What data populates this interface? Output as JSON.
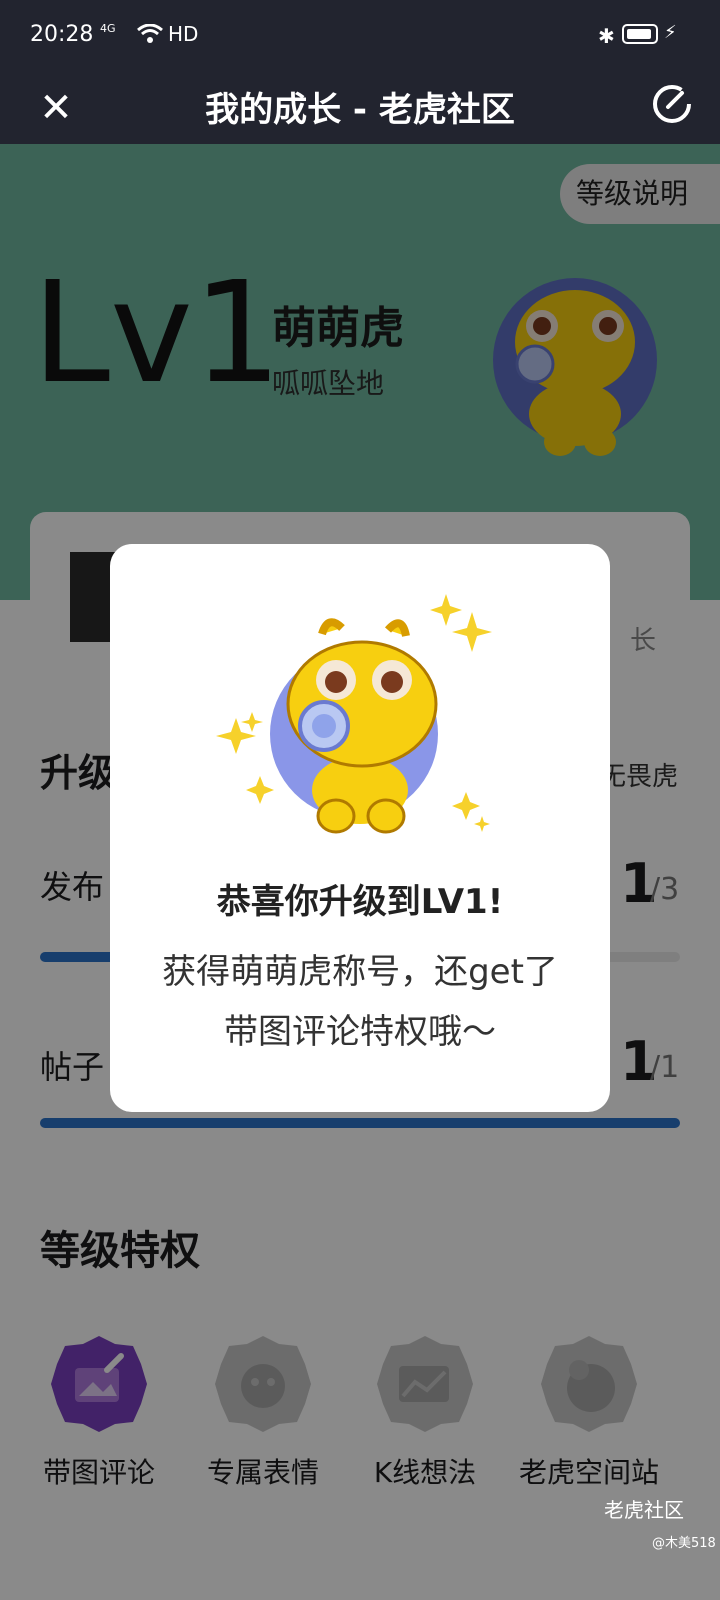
{
  "status_bar": {
    "time": "20:28",
    "signal_label": "4G",
    "network": "HD"
  },
  "nav": {
    "title": "我的成长 - 老虎社区"
  },
  "hero": {
    "level_help": "等级说明",
    "level": "Lv1",
    "rank_name": "萌萌虎",
    "rank_subtitle": "呱呱坠地"
  },
  "card": {
    "more_text": "长"
  },
  "upgrade": {
    "title_partial": "升级",
    "next_rank_partial": "无畏虎",
    "tasks": [
      {
        "label_partial": "发布",
        "done": "1",
        "total": "/3",
        "progress": 0.333
      },
      {
        "label_partial": "帖子",
        "done": "1",
        "total": "/1",
        "progress": 1.0
      }
    ]
  },
  "privileges": {
    "title": "等级特权",
    "items": [
      {
        "label": "带图评论",
        "icon": "photo-comment-icon",
        "active": true
      },
      {
        "label": "专属表情",
        "icon": "exclusive-emoji-icon",
        "active": false
      },
      {
        "label": "K线想法",
        "icon": "kline-idea-icon",
        "active": false
      },
      {
        "label": "老虎空间站",
        "icon": "space-station-icon",
        "active": false
      }
    ]
  },
  "dialog": {
    "headline": "恭喜你升级到LV1!",
    "line1": "获得萌萌虎称号，还get了",
    "line2": "带图评论特权哦～"
  },
  "watermark": {
    "brand": "老虎社区",
    "user": "@木美518"
  },
  "colors": {
    "header_bg": "#22242f",
    "hero_bg": "#6fb8a0",
    "progress_blue": "#2b73c9",
    "badge_purple": "#7a3fc0"
  }
}
